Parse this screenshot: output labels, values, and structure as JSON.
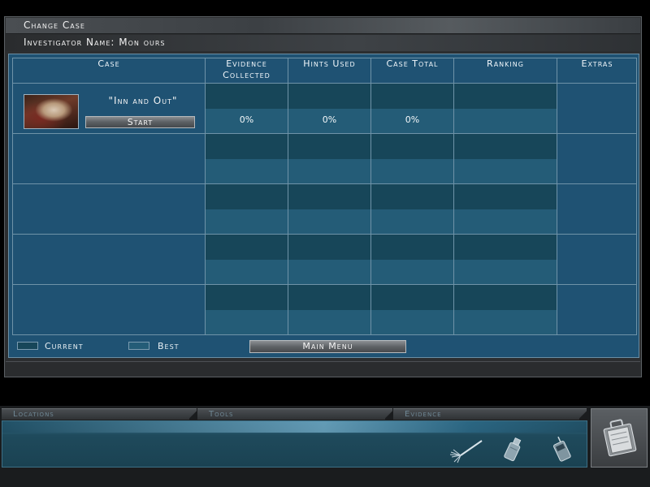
{
  "dialog": {
    "title": "Change Case",
    "investigator_label": "Investigator Name: Mon ours"
  },
  "table": {
    "columns": [
      "Case",
      "Evidence\nCollected",
      "Hints Used",
      "Case Total",
      "Ranking",
      "Extras"
    ],
    "rows": [
      {
        "case_name": "\"Inn and Out\"",
        "start_label": "Start",
        "evidence": "0%",
        "hints": "0%",
        "total": "0%"
      }
    ]
  },
  "legend": {
    "current": "Current",
    "best": "Best"
  },
  "main_menu_label": "Main Menu",
  "toolbar": {
    "tabs": [
      "Locations",
      "Tools",
      "Evidence"
    ]
  },
  "colors": {
    "panel": "#1f5273",
    "cell_current": "#174659",
    "cell_best": "#245c77"
  },
  "icons": [
    "duster-brush-icon",
    "spray-bottle-icon",
    "phone-scanner-icon",
    "briefcase-icon"
  ]
}
